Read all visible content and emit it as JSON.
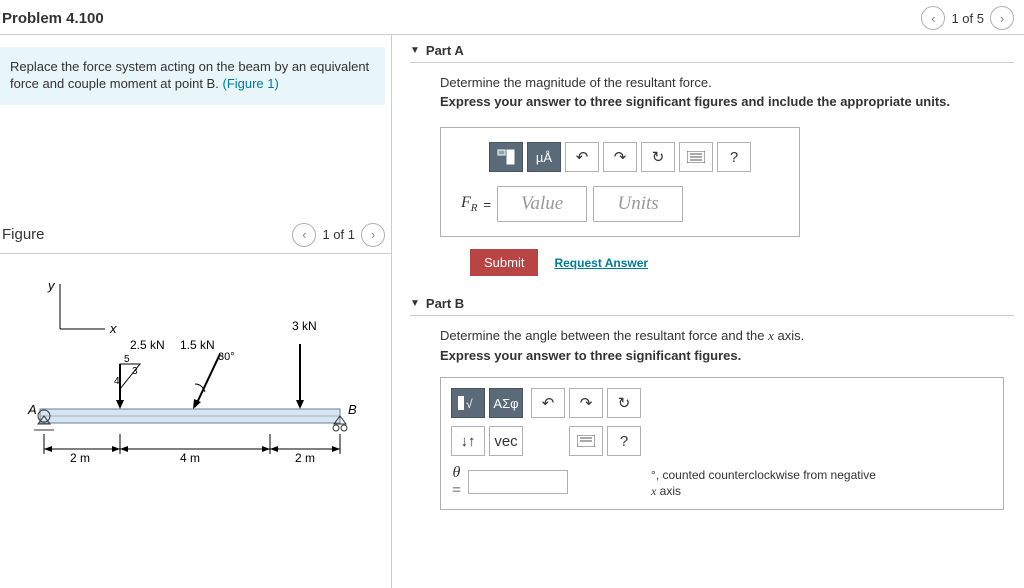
{
  "header": {
    "title": "Problem 4.100",
    "pager": "1 of 5"
  },
  "prompt": {
    "text": "Replace the force system acting on the beam by an equivalent force and couple moment at point B.",
    "figure_link": "(Figure 1)"
  },
  "figure": {
    "label": "Figure",
    "pager": "1 of 1",
    "diagram": {
      "axes": {
        "y": "y",
        "x": "x"
      },
      "forces": {
        "f1": "2.5 kN",
        "f2": "1.5 kN",
        "f3": "3 kN"
      },
      "angle": "30°",
      "ratio": {
        "a": "5",
        "b": "3",
        "c": "4"
      },
      "points": {
        "A": "A",
        "B": "B"
      },
      "dims": {
        "d1": "2 m",
        "d2": "4 m",
        "d3": "2 m"
      }
    }
  },
  "partA": {
    "title": "Part A",
    "q": "Determine the magnitude of the resultant force.",
    "instr": "Express your answer to three significant figures and include the appropriate units.",
    "mu": "µÅ",
    "help": "?",
    "var": "F",
    "sub": "R",
    "eq": "=",
    "value_ph": "Value",
    "units_ph": "Units",
    "submit": "Submit",
    "request": "Request Answer"
  },
  "partB": {
    "title": "Part B",
    "q_pre": "Determine the angle between the resultant force and the ",
    "q_var": "x",
    "q_post": " axis.",
    "instr": "Express your answer to three significant figures.",
    "sym": "ΑΣφ",
    "vec": "vec",
    "arrows": "↓↑",
    "help": "?",
    "theta": "θ",
    "eq": "=",
    "suffix_deg": "°",
    "suffix_txt": ", counted counterclockwise from negative ",
    "suffix_var": "x",
    "suffix_end": " axis"
  }
}
